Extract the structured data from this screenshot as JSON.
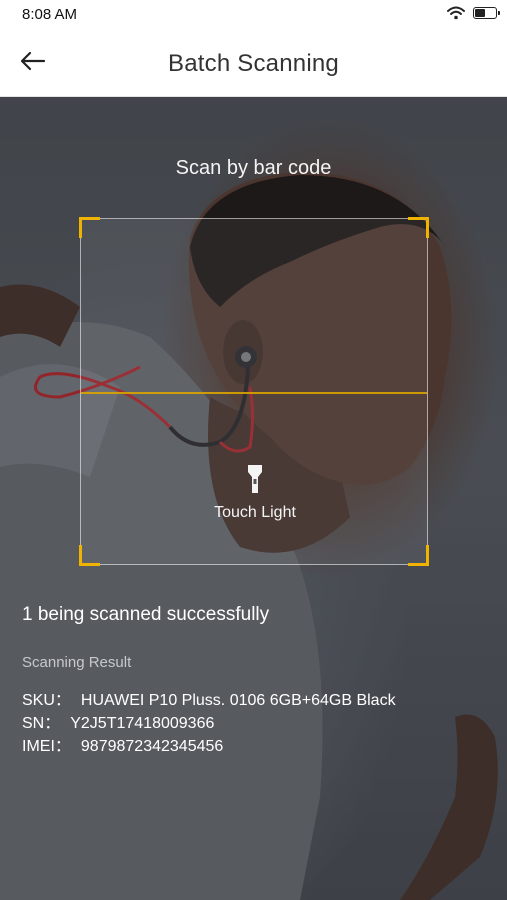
{
  "status_bar": {
    "time": "8:08 AM",
    "wifi_icon": "wifi-icon",
    "battery_icon": "battery-icon",
    "battery_level": 0.55
  },
  "nav": {
    "back_icon": "arrow-left-icon",
    "title": "Batch Scanning"
  },
  "scanner": {
    "heading": "Scan by bar code",
    "accent_color": "#f0b400",
    "touch_light_icon": "flashlight-icon",
    "touch_light_label": "Touch Light"
  },
  "result": {
    "status": "1 being scanned successfully",
    "heading": "Scanning Result",
    "sku_label": "SKU：",
    "sku_value": "HUAWEI P10 Pluss. 0106 6GB+64GB Black",
    "sn_label": "SN：",
    "sn_value": "Y2J5T17418009366",
    "imei_label": "IMEI：",
    "imei_value": "9879872342345456"
  }
}
